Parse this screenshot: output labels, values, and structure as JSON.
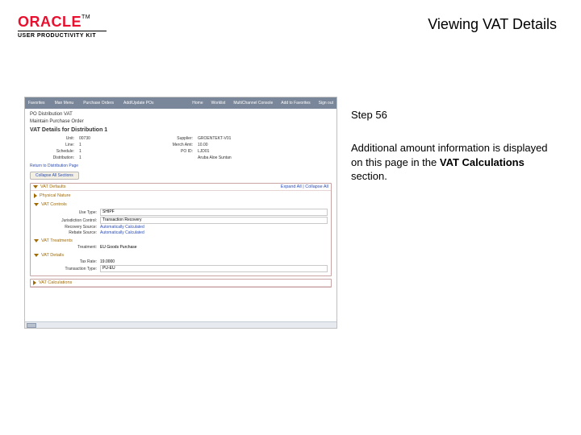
{
  "header": {
    "brand": "ORACLE",
    "tm": "TM",
    "subbrand": "USER PRODUCTIVITY KIT",
    "title": "Viewing VAT Details"
  },
  "step": {
    "label": "Step 56",
    "desc_a": "Additional amount information is displayed on this page in the ",
    "desc_b": "VAT Calculations",
    "desc_c": " section."
  },
  "shot": {
    "menubar": {
      "m0": "Favorites",
      "m1": "Man Menu",
      "m2": "Purchase Orders",
      "m3": "Add/Update POs",
      "r0": "Home",
      "r1": "Worklist",
      "r2": "MultiChannel Console",
      "r3": "Add to Favorites",
      "r4": "Sign out"
    },
    "breadcrumb": "PO Distribution VAT",
    "module": "Maintain Purchase Order",
    "page_title": "VAT Details for Distribution 1",
    "top": {
      "unit_l": "Unit:",
      "unit_v": "00730",
      "line_l": "Line:",
      "line_v": "1",
      "sched_l": "Schedule:",
      "sched_v": "1",
      "dist_l": "Distribution:",
      "dist_v": "1",
      "supp_l": "Supplier:",
      "supp_v": "GROENTEKT-V01",
      "merch_l": "Merch Amt:",
      "merch_v": "10.00",
      "poid_l": "PO ID:",
      "poid_v": "LJD01",
      "desc_l": "",
      "desc_v": "Aruba Aloe Suntan"
    },
    "return": "Return to Distribution Page",
    "buttons": {
      "collapse": "Collapse All Sections"
    },
    "panels": {
      "defaults": "VAT Defaults",
      "exp_col": "Expand All | Collapse All",
      "phys": "Physical Nature",
      "controls": {
        "title": "VAT Controls",
        "use_type_l": "Use Type:",
        "use_type_v": "SHIPF",
        "jur_l": "Jurisdiction Control:",
        "jur_v": "Transaction Recovery",
        "rec_src_l": "Recovery Source:",
        "rec_src_v": "Automatically Calculated",
        "reb_src_l": "Rebate Source:",
        "reb_src_v": "Automatically Calculated"
      },
      "treatments": {
        "title": "VAT Treatments",
        "treat_l": "Treatment:",
        "treat_v": "EU Goods Purchase"
      },
      "details": {
        "title": "VAT Details",
        "rate_l": "Tax Rate:",
        "rate_v": "19.0000",
        "ttype_l": "Transaction Type:",
        "ttype_v": "PU-EU"
      },
      "calcs": "VAT Calculations"
    }
  }
}
